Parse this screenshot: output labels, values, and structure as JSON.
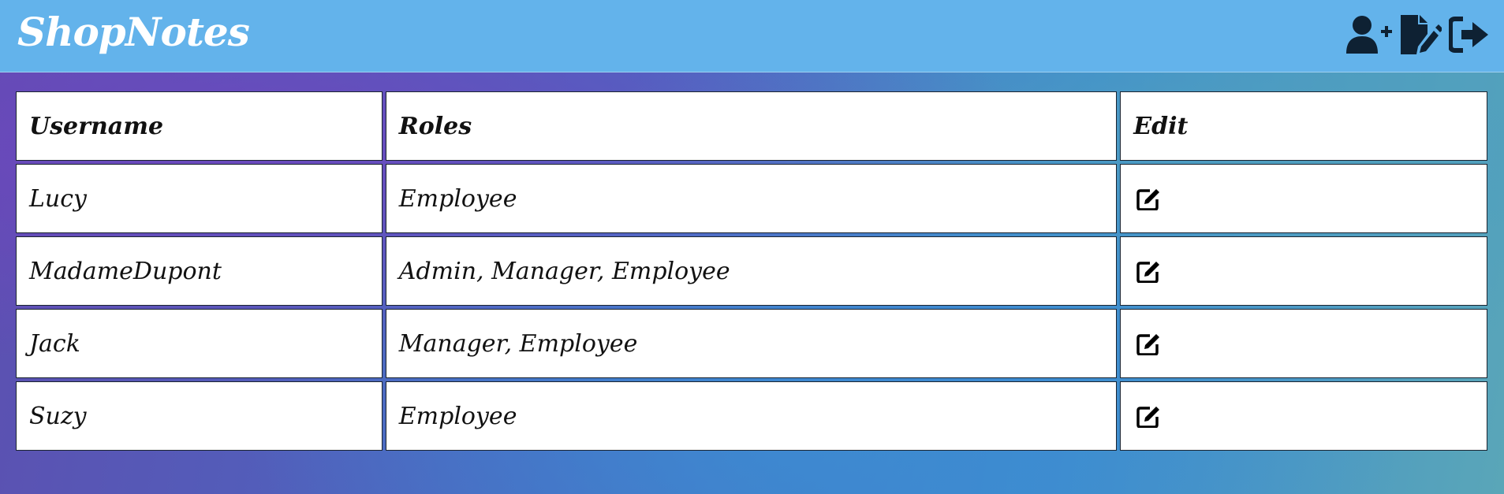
{
  "app": {
    "title": "ShopNotes"
  },
  "nav": {
    "icons": [
      "user-plus-icon",
      "file-signature-icon",
      "sign-out-icon"
    ]
  },
  "table": {
    "headers": {
      "username": "Username",
      "roles": "Roles",
      "edit": "Edit"
    },
    "rows": [
      {
        "username": "Lucy",
        "roles": "Employee",
        "edit_icon": "edit-icon"
      },
      {
        "username": "MadameDupont",
        "roles": "Admin, Manager, Employee",
        "edit_icon": "edit-icon"
      },
      {
        "username": "Jack",
        "roles": "Manager, Employee",
        "edit_icon": "edit-icon"
      },
      {
        "username": "Suzy",
        "roles": "Employee",
        "edit_icon": "edit-icon"
      }
    ]
  },
  "colors": {
    "navbar": "#63b3eb",
    "brand_text": "#ffffff",
    "icon": "#0e2133"
  }
}
